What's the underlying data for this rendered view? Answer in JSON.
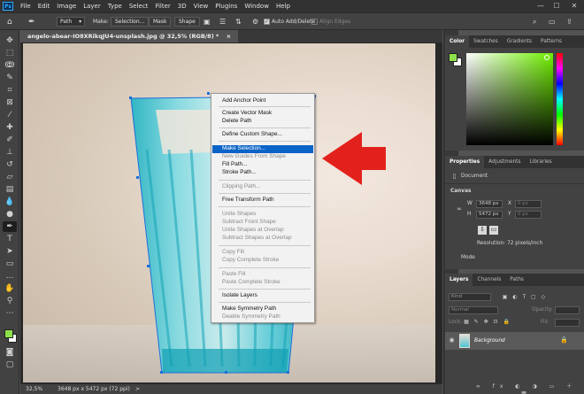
{
  "app": {
    "logo": "Ps"
  },
  "menubar": {
    "items": [
      "File",
      "Edit",
      "Image",
      "Layer",
      "Type",
      "Select",
      "Filter",
      "3D",
      "View",
      "Plugins",
      "Window",
      "Help"
    ]
  },
  "window_controls": [
    "—",
    "☐",
    "✕"
  ],
  "options_bar": {
    "mode_value": "Path",
    "make_label": "Make:",
    "selection_button": "Selection...",
    "mask_button": "Mask",
    "shape_button": "Shape",
    "auto_add_delete": "Auto Add/Delete",
    "align_edges": "Align Edges"
  },
  "document_tab": {
    "title": "angelo-abear-IO8XRikqJU4-unsplash.jpg @ 32,5% (RGB/8) *",
    "close": "×"
  },
  "context_menu": {
    "items": [
      {
        "label": "Add Anchor Point",
        "disabled": false
      },
      {
        "label": "Create Vector Mask",
        "disabled": false
      },
      {
        "label": "Delete Path",
        "disabled": false
      },
      {
        "label": "Define Custom Shape...",
        "disabled": false
      },
      {
        "label": "Make Selection...",
        "disabled": false,
        "highlighted": true
      },
      {
        "label": "New Guides From Shape",
        "disabled": true
      },
      {
        "label": "Fill Path...",
        "disabled": false
      },
      {
        "label": "Stroke Path...",
        "disabled": false
      },
      {
        "label": "Clipping Path...",
        "disabled": true
      },
      {
        "label": "Free Transform Path",
        "disabled": false
      },
      {
        "label": "Unite Shapes",
        "disabled": true
      },
      {
        "label": "Subtract Front Shape",
        "disabled": true
      },
      {
        "label": "Unite Shapes at Overlap",
        "disabled": true
      },
      {
        "label": "Subtract Shapes at Overlap",
        "disabled": true
      },
      {
        "label": "Copy Fill",
        "disabled": true
      },
      {
        "label": "Copy Complete Stroke",
        "disabled": true
      },
      {
        "label": "Paste Fill",
        "disabled": true
      },
      {
        "label": "Paste Complete Stroke",
        "disabled": true
      },
      {
        "label": "Isolate Layers",
        "disabled": false
      },
      {
        "label": "Make Symmetry Path",
        "disabled": false
      },
      {
        "label": "Deable Symmetry Path",
        "disabled": true
      }
    ]
  },
  "status_bar": {
    "zoom": "32,5%",
    "doc_info": "3648 px x 5472 px (72 ppi)",
    "arrow": ">"
  },
  "color_panel": {
    "tabs": [
      "Color",
      "Swatches",
      "Gradients",
      "Patterns"
    ],
    "foreground": "#8ee04a",
    "background": "#ffffff"
  },
  "properties_panel": {
    "tabs": [
      "Properties",
      "Adjustments",
      "Libraries"
    ],
    "document_label": "Document",
    "canvas_label": "Canvas",
    "w_label": "W",
    "w_value": "3648 px",
    "h_label": "H",
    "h_value": "5472 px",
    "x_label": "X",
    "x_value": "0 px",
    "y_label": "Y",
    "y_value": "0 px",
    "resolution": "Resolution: 72 pixels/inch",
    "mode_label": "Mode"
  },
  "layers_panel": {
    "tabs": [
      "Layers",
      "Channels",
      "Paths"
    ],
    "kind_placeholder": "Kind",
    "blend_mode": "Normal",
    "opacity_label": "Opacity:",
    "lock_label": "Lock:",
    "fill_label": "Fill:",
    "layer_name": "Background"
  },
  "colors": {
    "accent": "#0a64c8",
    "arrow": "#e3211c",
    "glass": "#2ec6d6"
  }
}
